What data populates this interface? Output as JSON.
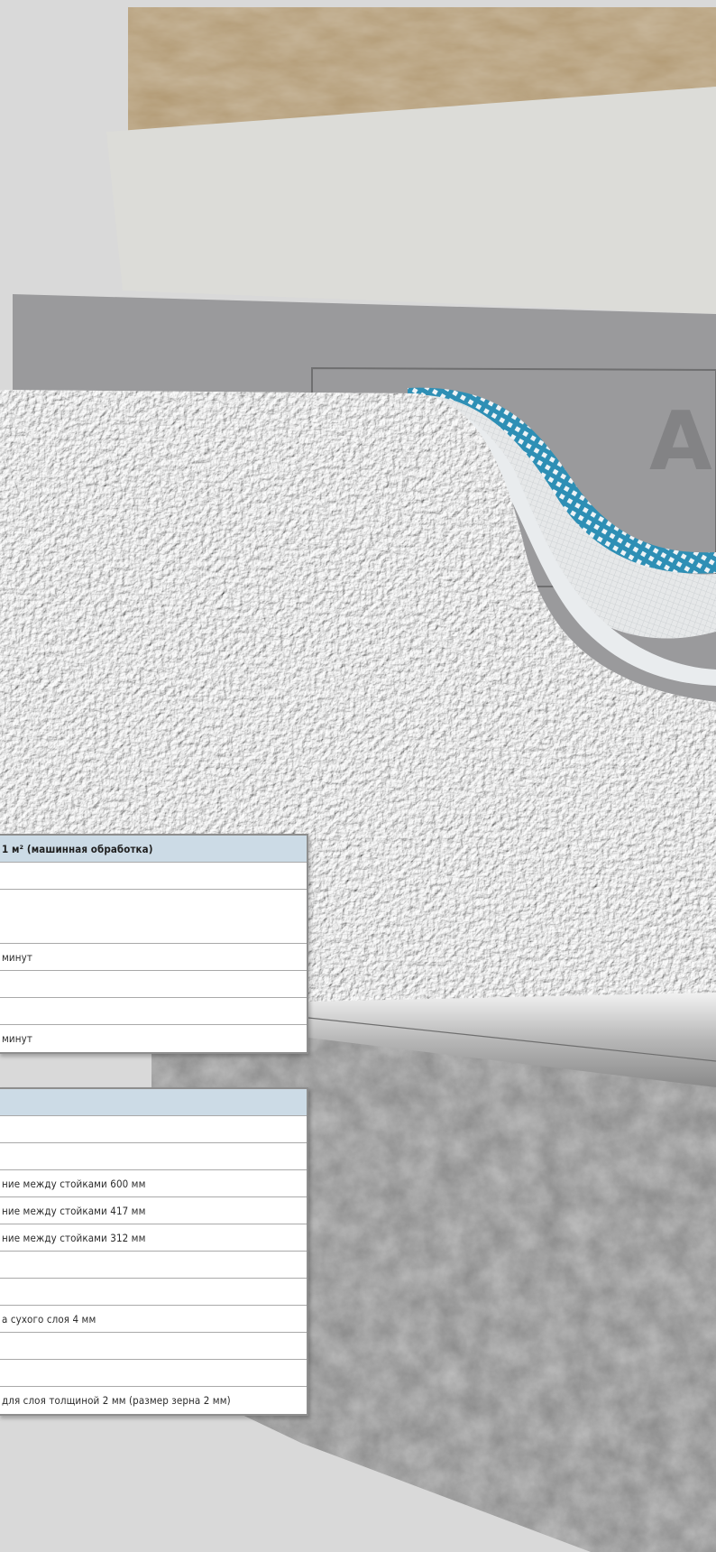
{
  "table1": {
    "header": "1 м² (машинная обработка)",
    "rows": [
      "",
      "",
      "минут",
      "",
      "",
      "минут"
    ]
  },
  "table2": {
    "header": "",
    "rows": [
      "",
      "",
      "ние между стойками 600 мм",
      "ние между стойками 417 мм",
      "ние между стойками 312 мм",
      "",
      "",
      "а сухого слоя 4 мм",
      "",
      "",
      "для слоя толщиной 2 мм (размер зерна 2 мм)"
    ]
  },
  "colors": {
    "insulation": "#b29a74",
    "membrane": "#dcdcd8",
    "board": "#9a9a9c",
    "mesh": "#2e8fb5",
    "plaster": "#f4f5f5",
    "concrete": "#8c8c8c",
    "header_fill": "#ccdbe6"
  }
}
